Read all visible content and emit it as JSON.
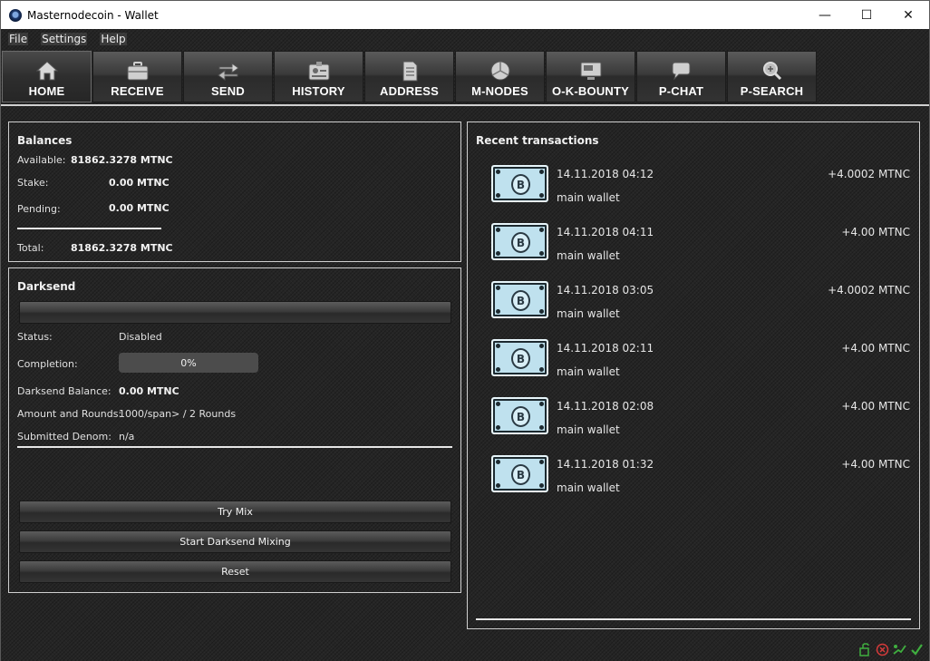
{
  "window": {
    "title": "Masternodecoin - Wallet",
    "controls": {
      "minimize": "—",
      "maximize": "☐",
      "close": "✕"
    }
  },
  "menu": [
    "File",
    "Settings",
    "Help"
  ],
  "toolbar": [
    {
      "label": "HOME",
      "icon": "home-icon",
      "active": true
    },
    {
      "label": "RECEIVE",
      "icon": "briefcase-icon",
      "active": false
    },
    {
      "label": "SEND",
      "icon": "arrows-icon",
      "active": false
    },
    {
      "label": "HISTORY",
      "icon": "id-card-icon",
      "active": false
    },
    {
      "label": "ADDRESS",
      "icon": "document-icon",
      "active": false
    },
    {
      "label": "M-NODES",
      "icon": "cube-icon",
      "active": false
    },
    {
      "label": "O-K-BOUNTY",
      "icon": "monitor-icon",
      "active": false
    },
    {
      "label": "P-CHAT",
      "icon": "chat-icon",
      "active": false
    },
    {
      "label": "P-SEARCH",
      "icon": "magnifier-icon",
      "active": false
    }
  ],
  "balances": {
    "title": "Balances",
    "available_label": "Available:",
    "available_value": "81862.3278 MTNC",
    "stake_label": "Stake:",
    "stake_value": "0.00 MTNC",
    "pending_label": "Pending:",
    "pending_value": "0.00 MTNC",
    "total_label": "Total:",
    "total_value": "81862.3278 MTNC"
  },
  "darksend": {
    "title": "Darksend",
    "status_label": "Status:",
    "status_value": "Disabled",
    "completion_label": "Completion:",
    "completion_value": "0%",
    "completion_fraction": 0,
    "balance_label": "Darksend Balance:",
    "balance_value": "0.00 MTNC",
    "rounds_label": "Amount and Rounds:",
    "rounds_value": "1000/span> / 2 Rounds",
    "denom_label": "Submitted Denom:",
    "denom_value": "n/a",
    "buttons": {
      "try_mix": "Try Mix",
      "start": "Start Darksend Mixing",
      "reset": "Reset"
    }
  },
  "recent": {
    "title": "Recent transactions",
    "items": [
      {
        "date": "14.11.2018 04:12",
        "wallet": "main wallet",
        "amount": "+4.0002 MTNC"
      },
      {
        "date": "14.11.2018 04:11",
        "wallet": "main wallet",
        "amount": "+4.00 MTNC"
      },
      {
        "date": "14.11.2018 03:05",
        "wallet": "main wallet",
        "amount": "+4.0002 MTNC"
      },
      {
        "date": "14.11.2018 02:11",
        "wallet": "main wallet",
        "amount": "+4.00 MTNC"
      },
      {
        "date": "14.11.2018 02:08",
        "wallet": "main wallet",
        "amount": "+4.00 MTNC"
      },
      {
        "date": "14.11.2018 01:32",
        "wallet": "main wallet",
        "amount": "+4.00 MTNC"
      }
    ],
    "coin_glyph": "B"
  },
  "statusbar": {
    "icons": [
      "lock-icon",
      "error-icon",
      "network-icon",
      "synced-check-icon"
    ]
  }
}
